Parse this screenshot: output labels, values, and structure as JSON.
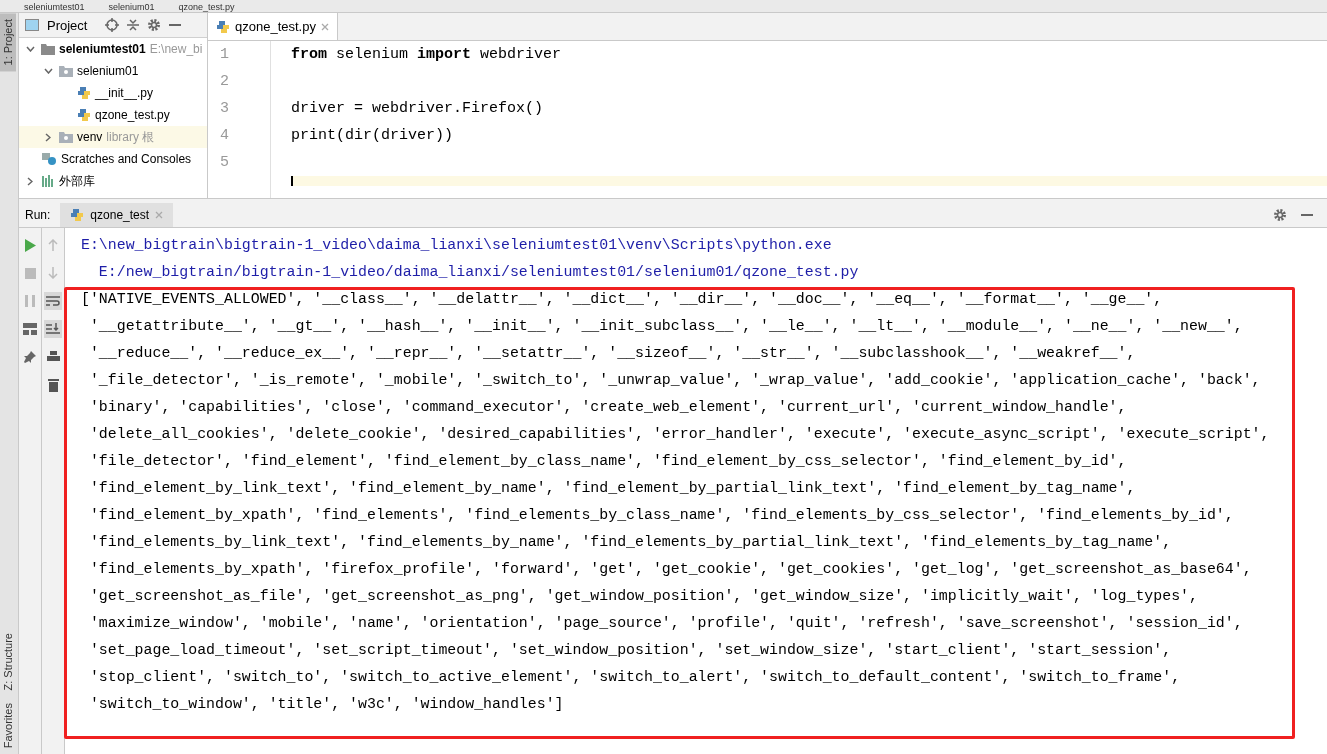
{
  "breadcrumbs": [
    "seleniumtest01",
    "selenium01",
    "qzone_test.py"
  ],
  "side_tabs": [
    {
      "label": "1: Project",
      "selected": true
    },
    {
      "label": "Z: Structure",
      "selected": false
    },
    {
      "label": "Favorites",
      "selected": false
    }
  ],
  "project_panel": {
    "title": "Project",
    "tree": [
      {
        "label": "seleniumtest01",
        "hint": "E:\\new_bi",
        "kind": "folder",
        "expanded": true,
        "selected": false,
        "children": [
          {
            "label": "selenium01",
            "kind": "package",
            "expanded": true,
            "selected": false,
            "children": [
              {
                "label": "__init__.py",
                "kind": "python",
                "selected": false
              },
              {
                "label": "qzone_test.py",
                "kind": "python",
                "selected": false
              }
            ]
          },
          {
            "label": "venv",
            "hint": "library 根",
            "kind": "package",
            "expanded": false,
            "selected": true
          }
        ]
      },
      {
        "label": "Scratches and Consoles",
        "kind": "scratches",
        "selected": false
      },
      {
        "label": "外部库",
        "kind": "library",
        "expanded": false,
        "selected": false
      }
    ]
  },
  "editor": {
    "tab": "qzone_test.py",
    "lines": [
      {
        "number": "1",
        "code": "**from** selenium **import** webdriver"
      },
      {
        "number": "2"
      },
      {
        "number": "3",
        "code": "driver = webdriver.Firefox()"
      },
      {
        "number": "4",
        "code": "print(dir(driver))"
      },
      {
        "number": "5"
      }
    ]
  },
  "run_panel": {
    "label": "Run:",
    "tab": "qzone_test",
    "output": [
      {
        "kind": "command",
        "text": "E:\\new_bigtrain\\bigtrain-1_video\\daima_lianxi\\seleniumtest01\\venv\\Scripts\\python.exe"
      },
      {
        "kind": "command",
        "text": "  E:/new_bigtrain/bigtrain-1_video/daima_lianxi/seleniumtest01/selenium01/qzone_test.py"
      },
      {
        "kind": "result",
        "text": "['NATIVE_EVENTS_ALLOWED', '__class__', '__delattr__', '__dict__', '__dir__', '__doc__', '__eq__', '__format__', '__ge__',"
      },
      {
        "kind": "result",
        "text": " '__getattribute__', '__gt__', '__hash__', '__init__', '__init_subclass__', '__le__', '__lt__', '__module__', '__ne__', '__new__',"
      },
      {
        "kind": "result",
        "text": " '__reduce__', '__reduce_ex__', '__repr__', '__setattr__', '__sizeof__', '__str__', '__subclasshook__', '__weakref__',"
      },
      {
        "kind": "result",
        "text": " '_file_detector', '_is_remote', '_mobile', '_switch_to', '_unwrap_value', '_wrap_value', 'add_cookie', 'application_cache', 'back',"
      },
      {
        "kind": "result",
        "text": " 'binary', 'capabilities', 'close', 'command_executor', 'create_web_element', 'current_url', 'current_window_handle',"
      },
      {
        "kind": "result",
        "text": " 'delete_all_cookies', 'delete_cookie', 'desired_capabilities', 'error_handler', 'execute', 'execute_async_script', 'execute_script',"
      },
      {
        "kind": "result",
        "text": " 'file_detector', 'find_element', 'find_element_by_class_name', 'find_element_by_css_selector', 'find_element_by_id',"
      },
      {
        "kind": "result",
        "text": " 'find_element_by_link_text', 'find_element_by_name', 'find_element_by_partial_link_text', 'find_element_by_tag_name',"
      },
      {
        "kind": "result",
        "text": " 'find_element_by_xpath', 'find_elements', 'find_elements_by_class_name', 'find_elements_by_css_selector', 'find_elements_by_id',"
      },
      {
        "kind": "result",
        "text": " 'find_elements_by_link_text', 'find_elements_by_name', 'find_elements_by_partial_link_text', 'find_elements_by_tag_name',"
      },
      {
        "kind": "result",
        "text": " 'find_elements_by_xpath', 'firefox_profile', 'forward', 'get', 'get_cookie', 'get_cookies', 'get_log', 'get_screenshot_as_base64',"
      },
      {
        "kind": "result",
        "text": " 'get_screenshot_as_file', 'get_screenshot_as_png', 'get_window_position', 'get_window_size', 'implicitly_wait', 'log_types',"
      },
      {
        "kind": "result",
        "text": " 'maximize_window', 'mobile', 'name', 'orientation', 'page_source', 'profile', 'quit', 'refresh', 'save_screenshot', 'session_id',"
      },
      {
        "kind": "result",
        "text": " 'set_page_load_timeout', 'set_script_timeout', 'set_window_position', 'set_window_size', 'start_client', 'start_session',"
      },
      {
        "kind": "result",
        "text": " 'stop_client', 'switch_to', 'switch_to_active_element', 'switch_to_alert', 'switch_to_default_content', 'switch_to_frame',"
      },
      {
        "kind": "result",
        "text": " 'switch_to_window', 'title', 'w3c', 'window_handles']"
      }
    ]
  }
}
